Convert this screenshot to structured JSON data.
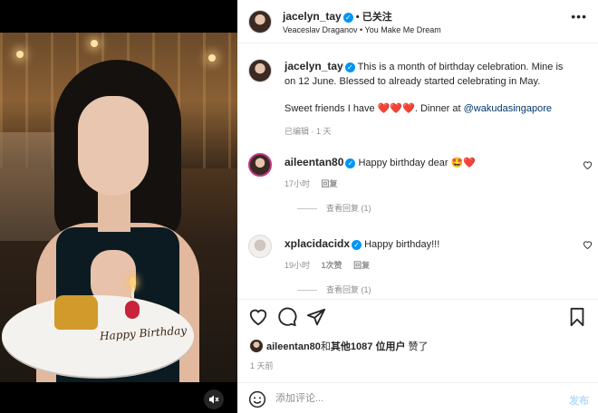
{
  "header": {
    "username": "jacelyn_tay",
    "follow_separator": "•",
    "follow_label": "已关注",
    "subtitle": "Veaceslav Draganov • You Make Me Dream",
    "more_icon": "more-horizontal-icon"
  },
  "caption": {
    "username": "jacelyn_tay",
    "text_1": "This is a month of birthday celebration. Mine is on 12 June. Blessed to already started celebrating in May.",
    "text_2_prefix": "Sweet friends I have ",
    "hearts": "❤️❤️❤️",
    "text_2_mid": ". Dinner at ",
    "mention": "@wakudasingapore",
    "meta": "已编辑 · 1 天"
  },
  "comments": [
    {
      "username": "aileentan80",
      "text": "Happy birthday dear 🤩❤️",
      "time": "17小时",
      "reply_label": "回复",
      "view_replies": "查看回复 (1)"
    },
    {
      "username": "xplacidacidx",
      "text": "Happy birthday!!!",
      "time": "19小时",
      "likes_label": "1次赞",
      "reply_label": "回复",
      "view_replies": "查看回复 (1)"
    }
  ],
  "likes": {
    "user": "aileentan80",
    "connector": "和",
    "others": "其他1087 位用户",
    "suffix": "赞了"
  },
  "post_time": "1 天前",
  "composer": {
    "placeholder": "添加评论...",
    "post_label": "发布"
  },
  "photo": {
    "plate_text": "Happy Birthday",
    "mute_icon": "muted-speaker-icon"
  },
  "colors": {
    "verified": "#0095f6",
    "mention": "#00376b",
    "post_button": "#b3dbff",
    "heart": "#ed4956"
  }
}
